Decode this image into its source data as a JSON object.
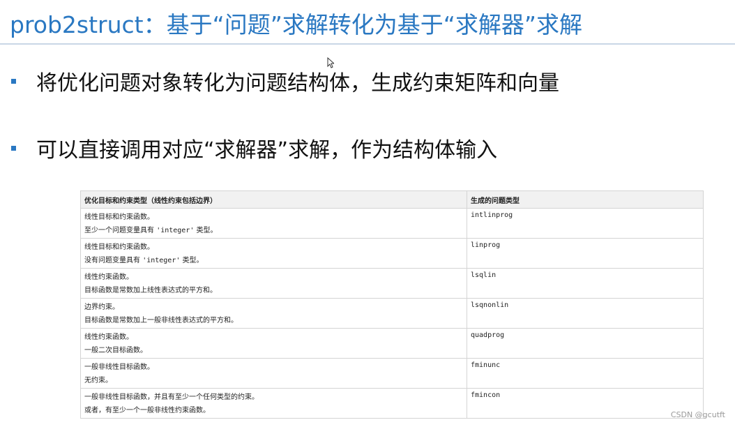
{
  "slide": {
    "title": "prob2struct：基于“问题”求解转化为基于“求解器”求解",
    "bullets": [
      "将优化问题对象转化为问题结构体，生成约束矩阵和向量",
      "可以直接调用对应“求解器”求解，作为结构体输入"
    ]
  },
  "table": {
    "headers": [
      "优化目标和约束类型（线性约束包括边界）",
      "生成的问题类型"
    ],
    "rows": [
      {
        "line1": "线性目标和约束函数。",
        "line2_pre": "至少一个问题变量具有 ",
        "line2_code": "'integer'",
        "line2_post": " 类型。",
        "solver": "intlinprog"
      },
      {
        "line1": "线性目标和约束函数。",
        "line2_pre": "没有问题变量具有 ",
        "line2_code": "'integer'",
        "line2_post": " 类型。",
        "solver": "linprog"
      },
      {
        "line1": "线性约束函数。",
        "line2_pre": "目标函数是常数加上线性表达式的平方和。",
        "line2_code": "",
        "line2_post": "",
        "solver": "lsqlin"
      },
      {
        "line1": "边界约束。",
        "line2_pre": "目标函数是常数加上一般非线性表达式的平方和。",
        "line2_code": "",
        "line2_post": "",
        "solver": "lsqnonlin"
      },
      {
        "line1": "线性约束函数。",
        "line2_pre": "一般二次目标函数。",
        "line2_code": "",
        "line2_post": "",
        "solver": "quadprog"
      },
      {
        "line1": "一般非线性目标函数。",
        "line2_pre": "无约束。",
        "line2_code": "",
        "line2_post": "",
        "solver": "fminunc"
      },
      {
        "line1": "一般非线性目标函数，并且有至少一个任何类型的约束。",
        "line2_pre": "或者，有至少一个一般非线性约束函数。",
        "line2_code": "",
        "line2_post": "",
        "solver": "fmincon"
      }
    ]
  },
  "watermark": "CSDN @gcutft",
  "colors": {
    "title": "#2a78c2",
    "bullet": "#2a78c2",
    "header_bg": "#f1f1f1"
  }
}
